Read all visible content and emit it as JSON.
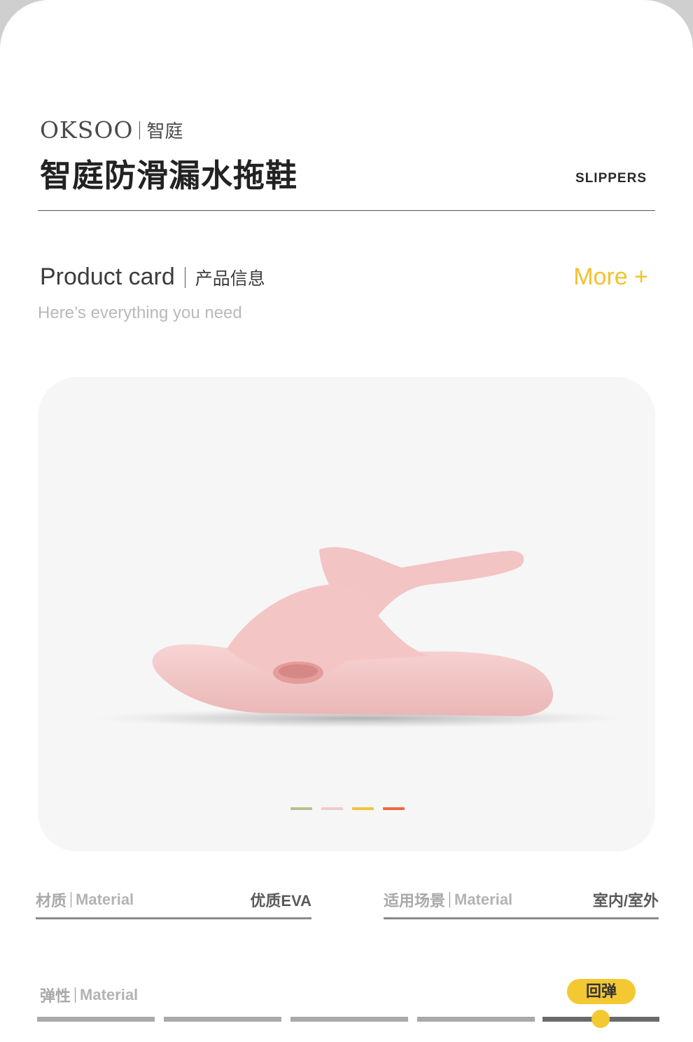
{
  "brand": {
    "logo": "OKSOO",
    "name_cn": "智庭"
  },
  "product": {
    "title": "智庭防滑漏水拖鞋",
    "tag": "SLIPPERS"
  },
  "section": {
    "title_en": "Product card",
    "title_cn": "产品信息",
    "more_label": "More +",
    "subtitle": "Here’s everything you need"
  },
  "gallery": {
    "slipper_color": "#f3c8c8",
    "color_dots": [
      "#b7bf8c",
      "#f4c9cb",
      "#f2c33c",
      "#ee6a43"
    ]
  },
  "specs": [
    {
      "label_cn": "材质",
      "label_en": "Material",
      "value": "优质EVA"
    },
    {
      "label_cn": "适用场景",
      "label_en": "Material",
      "value": "室内/室外"
    }
  ],
  "elasticity": {
    "label_cn": "弹性",
    "label_en": "Material",
    "value": "回弹",
    "level": 5,
    "max": 5
  },
  "colors": {
    "accent": "#f3c833",
    "text_dark": "#222222",
    "muted": "#b9b9b9"
  }
}
